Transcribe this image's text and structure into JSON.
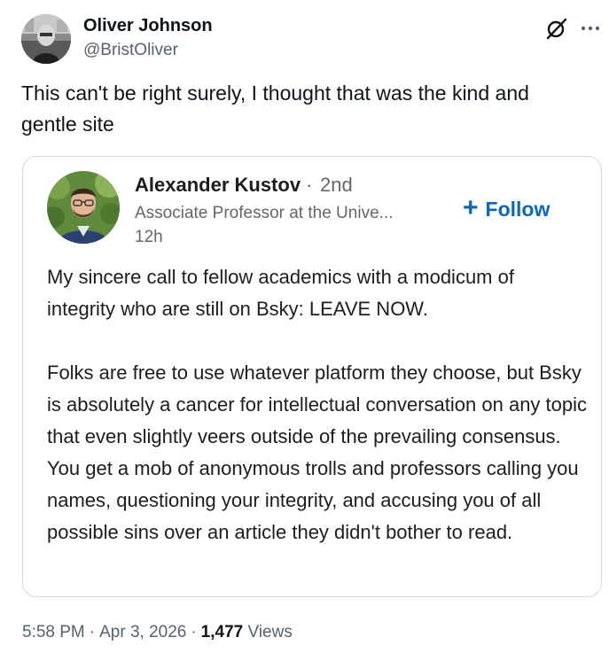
{
  "tweet": {
    "author": {
      "name": "Oliver Johnson",
      "handle": "@BristOliver",
      "avatar_icon": "profile-photo"
    },
    "header_icons": [
      "grok-icon",
      "more-options-icon"
    ],
    "text": "This can't be right surely, I thought that was the kind and gentle site",
    "quoted_post": {
      "author": {
        "name": "Alexander Kustov",
        "separator": "·",
        "degree": "2nd",
        "title": "Associate Professor at the Unive...",
        "time": "12h",
        "avatar_icon": "profile-photo"
      },
      "follow_plus": "+",
      "follow_label": "Follow",
      "paragraphs": [
        "My sincere call to fellow academics with a modicum of integrity who are still on Bsky: LEAVE NOW.",
        "Folks are free to use whatever platform they choose, but Bsky is absolutely a cancer for intellectual conversation on any topic that even slightly veers outside of the prevailing consensus. You get a mob of anonymous trolls and professors calling you names, questioning your integrity, and accusing you of all possible sins over an article they didn't bother to read."
      ]
    },
    "meta": {
      "time": "5:58 PM",
      "separator": "·",
      "date": "Apr 3, 2026",
      "views_count": "1,477",
      "views_label": "Views"
    }
  },
  "colors": {
    "text_primary": "#0f1419",
    "text_secondary": "#536471",
    "card_border": "#cfd9de",
    "linkedin_blue": "#0a66c2",
    "linkedin_gray": "#666666"
  }
}
